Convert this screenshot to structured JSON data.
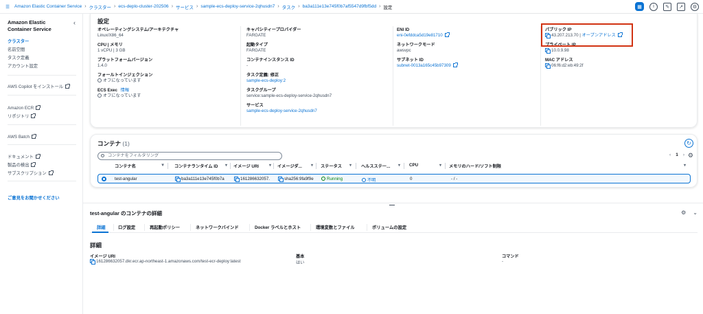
{
  "breadcrumbs": [
    "Amazon Elastic Container Service",
    "クラスター",
    "ecs-deplo-cluster-202506",
    "サービス",
    "sample-ecs-deploy-service-2qhusdn7",
    "タスク",
    "ba3a111e13e745f0b7af5547d9fbf5dd",
    "設定"
  ],
  "sidebar": {
    "title": "Amazon Elastic Container Service",
    "items": [
      "クラスター",
      "名前空間",
      "タスク定義",
      "アカウント設定"
    ],
    "copilot": "AWS Copilot をインストール",
    "ecr": "Amazon ECR",
    "repos": "リポジトリ",
    "batch": "AWS Batch",
    "docs": "ドキュメント",
    "discover": "製品の検出",
    "subs": "サブスクリプション",
    "feedback": "ご意見をお聞かせください"
  },
  "settings": {
    "title": "設定",
    "col1": {
      "os_label": "オペレーティングシステム/アーキテクチャ",
      "os_value": "Linux/X86_64",
      "cpu_label": "CPU | メモリ",
      "cpu_value": "1 vCPU | 3 GB",
      "platform_label": "プラットフォームバージョン",
      "platform_value": "1.4.0",
      "fault_label": "フォールトインジェクション",
      "fault_value": "オフになっています",
      "exec_label": "ECS Exec",
      "exec_info": "情報",
      "exec_value": "オフになっています"
    },
    "col2": {
      "cap_label": "キャパシティープロバイダー",
      "cap_value": "FARGATE",
      "launch_label": "起動タイプ",
      "launch_value": "FARGATE",
      "ci_label": "コンテナインスタンス ID",
      "ci_value": "-",
      "td_label": "タスク定義: 修正",
      "td_value": "sample-ecs-deploy:2",
      "tg_label": "タスクグループ",
      "tg_value": "service:sample-ecs-deploy-service-2qhusdn7",
      "svc_label": "サービス",
      "svc_value": "sample-ecs-deploy-service-2qhusdn7"
    },
    "col3": {
      "eni_label": "ENI ID",
      "eni_value": "eni-0efddca5d19e81710",
      "net_label": "ネットワークモード",
      "net_value": "awsvpc",
      "subnet_label": "サブネット ID",
      "subnet_value": "subnet-0013a165c45b97309"
    },
    "col4": {
      "pubip_label": "パブリック IP",
      "pubip_value": "43.207.213.70",
      "open_addr": "オープンアドレス",
      "privip_label": "プライベート IP",
      "privip_value": "10.0.9.98",
      "mac_label": "MAC アドレス",
      "mac_value": "06:f6:d2:eb:49:2f"
    }
  },
  "containers": {
    "title": "コンテナ",
    "count": "(1)",
    "search_placeholder": "コンテナをフィルタリング",
    "page": "1",
    "columns": [
      "コンテナ名",
      "コンテナランタイム ID",
      "イメージ URI",
      "イメージダ...",
      "ステータス",
      "ヘルスステー...",
      "CPU",
      "メモリのハード/ソフト制限"
    ],
    "row": {
      "name": "test-angular",
      "runtime": "ba3a111e13e745f0b7a",
      "image": "161286632057.",
      "digest": "sha256:9fa9f9e",
      "status": "Running",
      "health": "不明",
      "cpu": "0",
      "memory": "- / -"
    }
  },
  "detail": {
    "title": "test-angular のコンテナの詳細",
    "tabs": [
      "詳細",
      "ログ設定",
      "再起動ポリシー",
      "ネットワークバインド",
      "Docker ラベルとホスト",
      "環境変数とファイル",
      "ボリュームの設定"
    ],
    "section_title": "詳細",
    "image_uri_label": "イメージ URI",
    "image_uri_value": "161286632057.dkr.ecr.ap-northeast-1.amazonaws.com/test-ecr-deploy:latest",
    "essential_label": "基本",
    "essential_value": "はい",
    "command_label": "コマンド",
    "command_value": "-"
  },
  "colors": {
    "accent": "#0972d3",
    "highlight": "#d13212",
    "success": "#037f0c"
  }
}
